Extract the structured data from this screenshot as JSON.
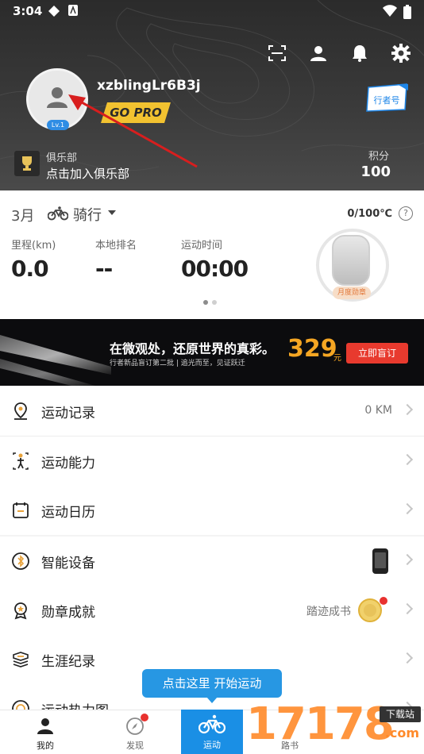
{
  "status_bar": {
    "time": "3:04"
  },
  "profile": {
    "username": "xzblingLr6B3j",
    "level": "Lv.1",
    "pro_label": "GO PRO",
    "xingzhe_label": "行者号",
    "club_title": "俱乐部",
    "club_action": "点击加入俱乐部",
    "points_label": "积分",
    "points_value": "100"
  },
  "stats": {
    "month": "3月",
    "sport": "骑行",
    "temperature": "0/100℃",
    "distance_label": "里程(km)",
    "distance_value": "0.0",
    "rank_label": "本地排名",
    "rank_value": "--",
    "time_label": "运动时间",
    "time_value": "00:00",
    "medal_label": "月度勋章"
  },
  "banner": {
    "title": "在微观处，还原世界的真彩。",
    "subtitle": "行者新品盲订第二批 | 追光而至，见证跃迁",
    "price": "329",
    "unit": "元",
    "button": "立即盲订"
  },
  "menu": {
    "items": [
      {
        "label": "运动记录",
        "right": "0 KM"
      },
      {
        "label": "运动能力",
        "right": ""
      },
      {
        "label": "运动日历",
        "right": ""
      },
      {
        "label": "智能设备",
        "right": ""
      },
      {
        "label": "勋章成就",
        "right": "踏迹成书"
      },
      {
        "label": "生涯纪录",
        "right": ""
      },
      {
        "label": "运动热力图",
        "right": ""
      }
    ]
  },
  "tooltip": {
    "text": "点击这里 开始运动"
  },
  "nav": {
    "items": [
      {
        "label": "我的"
      },
      {
        "label": "发现"
      },
      {
        "label": "运动"
      },
      {
        "label": "路书"
      }
    ]
  },
  "watermark": {
    "number": "17178",
    "tag": "下载站",
    "domain": ".com"
  },
  "colors": {
    "accent": "#1a8fe5",
    "banner_button": "#e83a2e",
    "price": "#f5a623",
    "arrow": "#d81e1e"
  }
}
